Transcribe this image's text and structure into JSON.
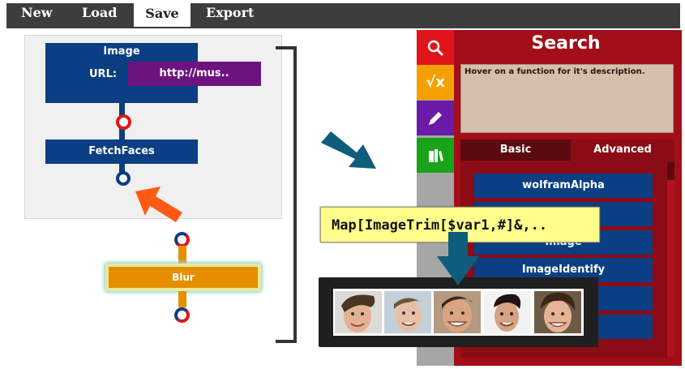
{
  "menu": {
    "new_label": "New",
    "load_label": "Load",
    "save_label": "Save",
    "export_label": "Export"
  },
  "canvas": {
    "image_node": {
      "title": "Image",
      "url_label": "URL:",
      "url_value": "http://mus.."
    },
    "fetchfaces_node": {
      "title": "FetchFaces"
    },
    "blur_node": {
      "title": "Blur"
    }
  },
  "side_panel": {
    "icons": [
      "search-icon",
      "sqrt-icon",
      "pencil-icon",
      "books-icon"
    ],
    "icon_colors": [
      "#e0151b",
      "#f5a000",
      "#6a1ba8",
      "#19a319"
    ],
    "title": "Search",
    "description": "Hover on a function for it's description.",
    "tabs": [
      {
        "label": "Basic",
        "active": true
      },
      {
        "label": "Advanced",
        "active": false
      }
    ],
    "functions": [
      "wolframAlpha",
      "",
      "Image",
      "ImageIdentify",
      "",
      ""
    ]
  },
  "tooltip": {
    "text": "Map[ImageTrim[$var1,#]&,.."
  },
  "colors": {
    "node_blue": "#0b3e82",
    "accent_red": "#a20f18",
    "url_purple": "#6c1380",
    "blur_orange": "#e58f00",
    "arrow_teal": "#0f5d7d",
    "arrow_orange": "#ff5a14"
  }
}
